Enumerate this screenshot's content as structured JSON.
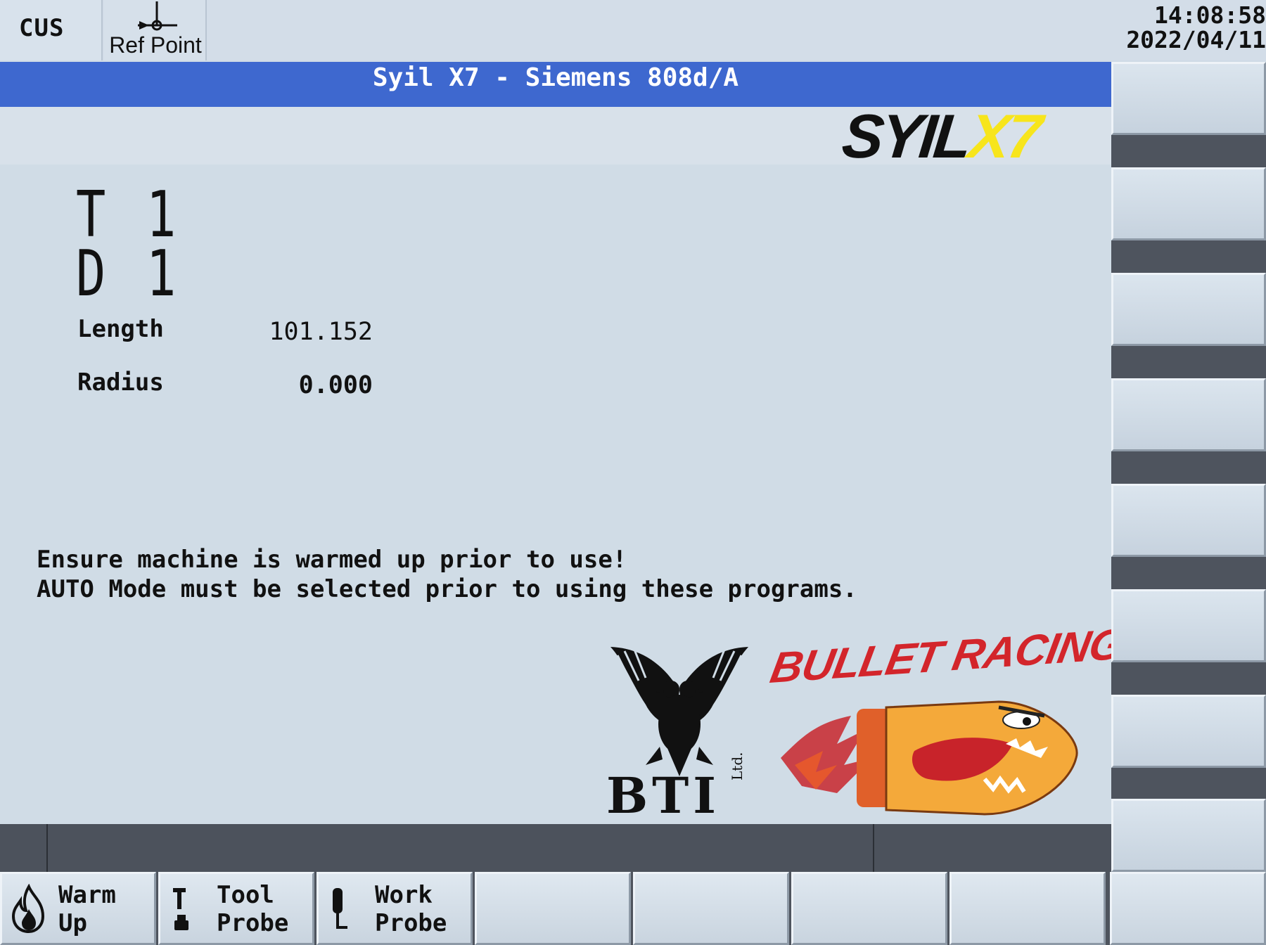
{
  "top_bar": {
    "mode": "CUS",
    "ref_point_label": "Ref Point",
    "ref_point_icon": "ref-point-icon",
    "time": "14:08:58",
    "date": "2022/04/11"
  },
  "title": "Syil X7 - Siemens 808d/A",
  "logos": {
    "syil_part1": "SYIL",
    "syil_part2": "X7",
    "bti": "BTI",
    "bti_suffix": "Ltd.",
    "racing": "BULLET RACING"
  },
  "tool": {
    "t_letter": "T",
    "t_value": "1",
    "d_letter": "D",
    "d_value": "1",
    "length_label": "Length",
    "length_value": "101.152",
    "radius_label": "Radius",
    "radius_value": "0.000"
  },
  "messages": {
    "line1": "Ensure machine is warmed up prior to use!",
    "line2": "AUTO Mode must be selected prior to using these programs."
  },
  "softkeys": [
    {
      "label": "Warm\nUp",
      "icon": "flame-icon"
    },
    {
      "label": "Tool\nProbe",
      "icon": "tool-probe-icon"
    },
    {
      "label": "Work\nProbe",
      "icon": "work-probe-icon"
    },
    {
      "label": ""
    },
    {
      "label": ""
    },
    {
      "label": ""
    },
    {
      "label": ""
    },
    {
      "label": ""
    }
  ],
  "colors": {
    "title_bar": "#3e68cf",
    "logo_yellow": "#f7e51c",
    "racing_red": "#d3252b",
    "screen_bg": "#d0dce6"
  }
}
